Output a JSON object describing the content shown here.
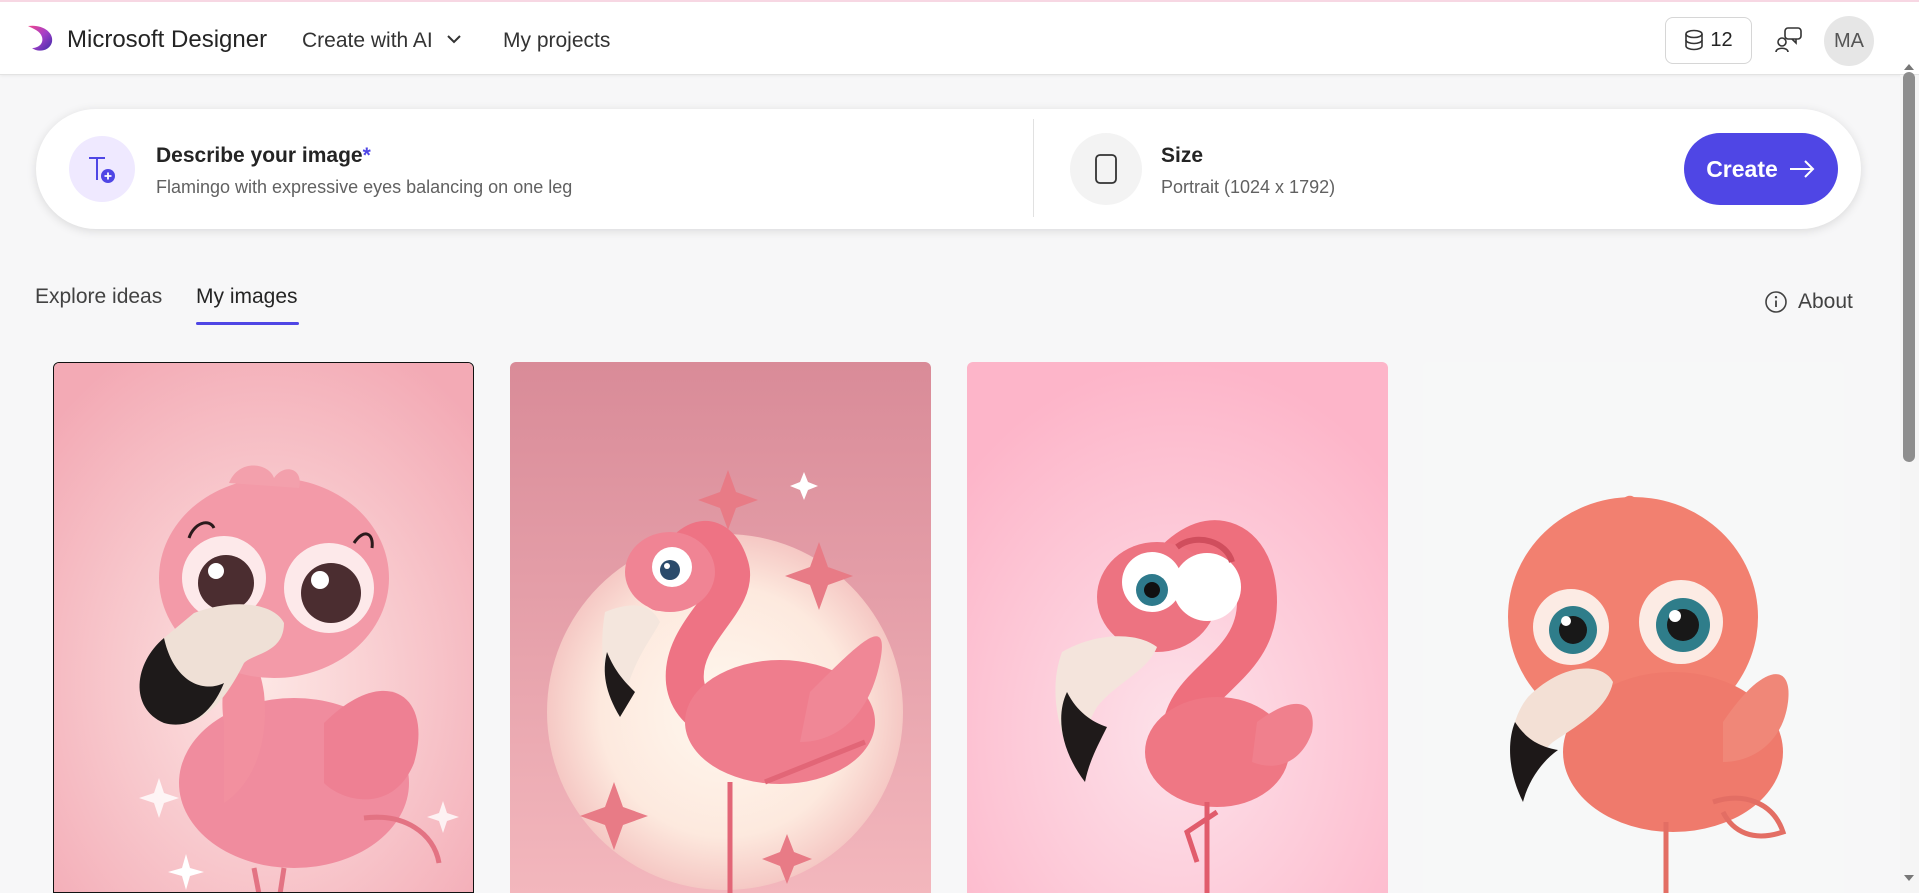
{
  "header": {
    "brand": "Microsoft Designer",
    "nav_create": "Create with AI",
    "nav_projects": "My projects",
    "credits": "12",
    "avatar_initials": "MA"
  },
  "prompt": {
    "describe_label": "Describe your image",
    "required_mark": "*",
    "describe_value": "Flamingo with expressive eyes balancing on one leg",
    "size_label": "Size",
    "size_value": "Portrait (1024 x 1792)",
    "create_label": "Create"
  },
  "tabs": [
    {
      "label": "Explore ideas",
      "active": false
    },
    {
      "label": "My images",
      "active": true
    }
  ],
  "about_label": "About",
  "colors": {
    "accent": "#4f46e5",
    "accent_light": "#efe9ff"
  },
  "images": [
    {
      "subject": "flamingo-with-big-eyes",
      "background": "#f3b3bb",
      "selected": true
    },
    {
      "subject": "flamingo-with-stars",
      "background": "#e89aa8",
      "selected": false
    },
    {
      "subject": "flamingo-on-pink",
      "background": "#fdb7cb",
      "selected": false
    },
    {
      "subject": "flamingo-on-white",
      "background": "#f7f8f8",
      "selected": false
    }
  ]
}
